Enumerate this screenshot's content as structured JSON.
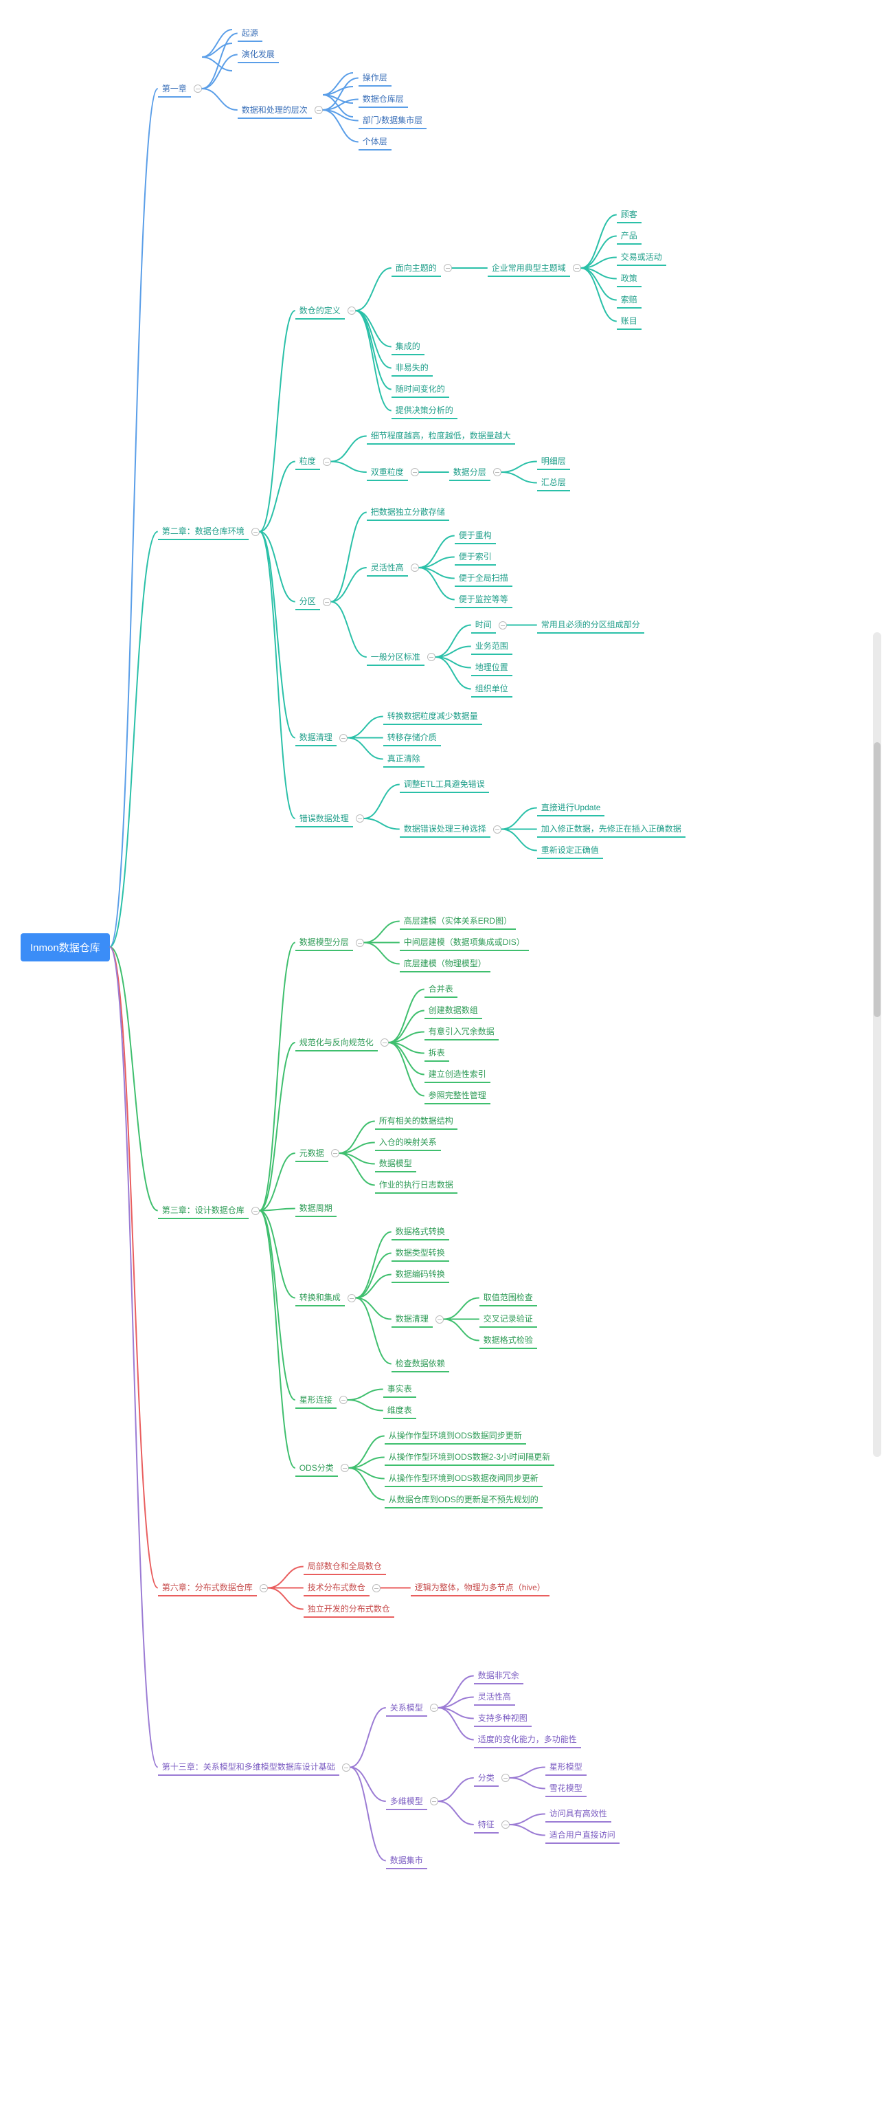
{
  "root": "Inmon数据仓库",
  "ch1": {
    "title": "第一章",
    "n1": "起源",
    "n2": "演化发展",
    "layers": {
      "title": "数据和处理的层次",
      "i1": "操作层",
      "i2": "数据仓库层",
      "i3": "部门/数据集市层",
      "i4": "个体层"
    }
  },
  "ch2": {
    "title": "第二章：数据仓库环境",
    "def": {
      "title": "数仓的定义",
      "subject": {
        "title": "面向主题的",
        "domain_label": "企业常用典型主题域",
        "d1": "顾客",
        "d2": "产品",
        "d3": "交易或活动",
        "d4": "政策",
        "d5": "索赔",
        "d6": "账目"
      },
      "i2": "集成的",
      "i3": "非易失的",
      "i4": "随时间变化的",
      "i5": "提供决策分析的"
    },
    "grain": {
      "title": "粒度",
      "i1": "细节程度越高，粒度越低，数据量越大",
      "dual": {
        "title": "双重粒度",
        "layer_label": "数据分层",
        "l1": "明细层",
        "l2": "汇总层"
      }
    },
    "partition": {
      "title": "分区",
      "i1": "把数据独立分散存储",
      "flex": {
        "title": "灵活性高",
        "f1": "便于重构",
        "f2": "便于索引",
        "f3": "便于全局扫描",
        "f4": "便于监控等等"
      },
      "std": {
        "title": "一般分区标准",
        "s1": {
          "label": "时间",
          "note": "常用且必须的分区组成部分"
        },
        "s2": "业务范围",
        "s3": "地理位置",
        "s4": "组织单位"
      }
    },
    "clean": {
      "title": "数据清理",
      "c1": "转换数据粒度减少数据量",
      "c2": "转移存储介质",
      "c3": "真正清除"
    },
    "error": {
      "title": "错误数据处理",
      "e1": "调整ETL工具避免错误",
      "choices": {
        "title": "数据错误处理三种选择",
        "o1": "直接进行Update",
        "o2": "加入修正数据，先修正在插入正确数据",
        "o3": "重新设定正确值"
      }
    }
  },
  "ch3": {
    "title": "第三章：设计数据仓库",
    "model": {
      "title": "数据模型分层",
      "m1": "高层建模（实体关系ERD图）",
      "m2": "中间层建模（数据项集成或DIS）",
      "m3": "底层建模（物理模型）"
    },
    "norm": {
      "title": "规范化与反向规范化",
      "n1": "合并表",
      "n2": "创建数据数组",
      "n3": "有意引入冗余数据",
      "n4": "拆表",
      "n5": "建立创造性索引",
      "n6": "参照完整性管理"
    },
    "meta": {
      "title": "元数据",
      "m1": "所有相关的数据结构",
      "m2": "入仓的映射关系",
      "m3": "数据模型",
      "m4": "作业的执行日志数据"
    },
    "cycle": "数据周期",
    "etl": {
      "title": "转换和集成",
      "t1": "数据格式转换",
      "t2": "数据类型转换",
      "t3": "数据编码转换",
      "clean": {
        "title": "数据清理",
        "c1": "取值范围检查",
        "c2": "交叉记录验证",
        "c3": "数据格式检验"
      },
      "t5": "检查数据依赖"
    },
    "star": {
      "title": "星形连接",
      "s1": "事实表",
      "s2": "维度表"
    },
    "ods": {
      "title": "ODS分类",
      "o1": "从操作作型环境到ODS数据同步更新",
      "o2": "从操作作型环境到ODS数据2-3小时间隔更新",
      "o3": "从操作作型环境到ODS数据夜间同步更新",
      "o4": "从数据仓库到ODS的更新是不预先规划的"
    }
  },
  "ch6": {
    "title": "第六章：分布式数据仓库",
    "i1": "局部数仓和全局数仓",
    "i2": {
      "label": "技术分布式数仓",
      "note": "逻辑为整体，物理为多节点（hive）"
    },
    "i3": "独立开发的分布式数仓"
  },
  "ch13": {
    "title": "第十三章：关系模型和多维模型数据库设计基础",
    "rel": {
      "title": "关系模型",
      "r1": "数据非冗余",
      "r2": "灵活性高",
      "r3": "支持多种视图",
      "r4": "适度的变化能力，多功能性"
    },
    "dim": {
      "title": "多维模型",
      "kind": {
        "title": "分类",
        "k1": "星形模型",
        "k2": "雪花模型"
      },
      "feat": {
        "title": "特征",
        "f1": "访问具有高效性",
        "f2": "适合用户直接访问"
      }
    },
    "mart": "数据集市"
  }
}
